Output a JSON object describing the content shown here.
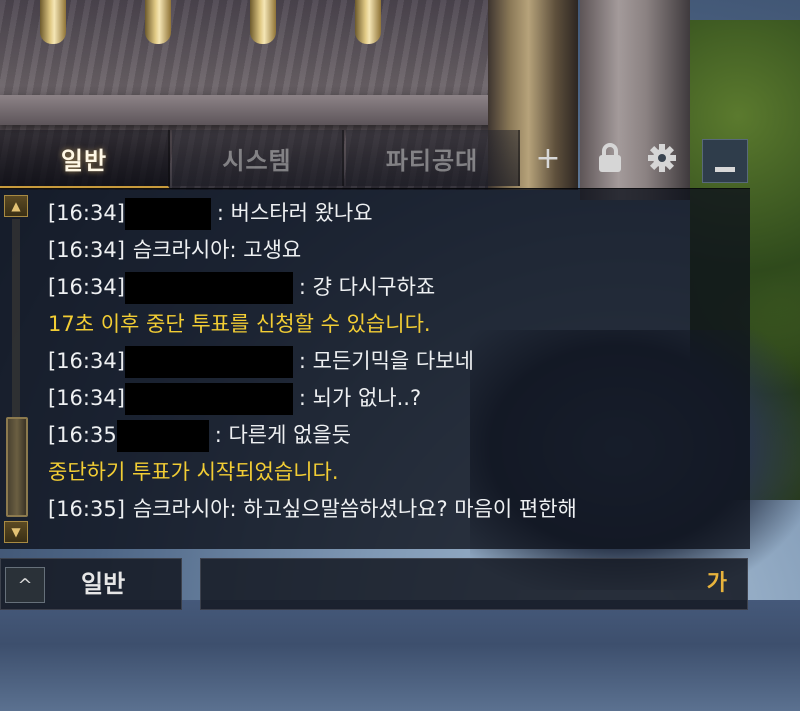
{
  "tabs": [
    {
      "label": "일반",
      "active": true
    },
    {
      "label": "시스템",
      "active": false
    },
    {
      "label": "파티공대",
      "active": false
    }
  ],
  "tab_controls": {
    "add_glyph": "+",
    "icons": [
      "add-tab-icon",
      "lock-icon",
      "gear-icon",
      "minimize-icon"
    ]
  },
  "messages": [
    {
      "type": "user",
      "time": "[16:34]",
      "sender": "",
      "text": ": 버스타러 왔나요",
      "redacted": true
    },
    {
      "type": "user",
      "time": "[16:34]",
      "sender": "슴크라시아",
      "text": " : 고생요",
      "redacted": false
    },
    {
      "type": "user",
      "time": "[16:34]",
      "sender": "",
      "text": ": 걍 다시구하죠",
      "redacted": true
    },
    {
      "type": "system",
      "text": "17초 이후 중단 투표를 신청할 수 있습니다."
    },
    {
      "type": "user",
      "time": "[16:34]",
      "sender": "",
      "text": ": 모든기믹을 다보네",
      "redacted": true
    },
    {
      "type": "user",
      "time": "[16:34]",
      "sender": "",
      "text": ": 뇌가 없나..?",
      "redacted": true
    },
    {
      "type": "user",
      "time": "[16:35",
      "sender": "",
      "text": ": 다른게 없을듯",
      "redacted": true
    },
    {
      "type": "system",
      "text": "중단하기 투표가 시작되었습니다."
    },
    {
      "type": "user",
      "time": "[16:35]",
      "sender": "슴크라시아",
      "text": " : 하고싶으말씀하셨나요? 마음이 편한해",
      "redacted": false
    }
  ],
  "bottom": {
    "channel_label": "일반",
    "channel_toggle_glyph": "^",
    "input_value": "",
    "input_placeholder": "",
    "ime_indicator": "가"
  },
  "colors": {
    "system_text": "#f2cd34",
    "chat_text": "#eef0f2",
    "accent_gold": "#c79a3c"
  }
}
